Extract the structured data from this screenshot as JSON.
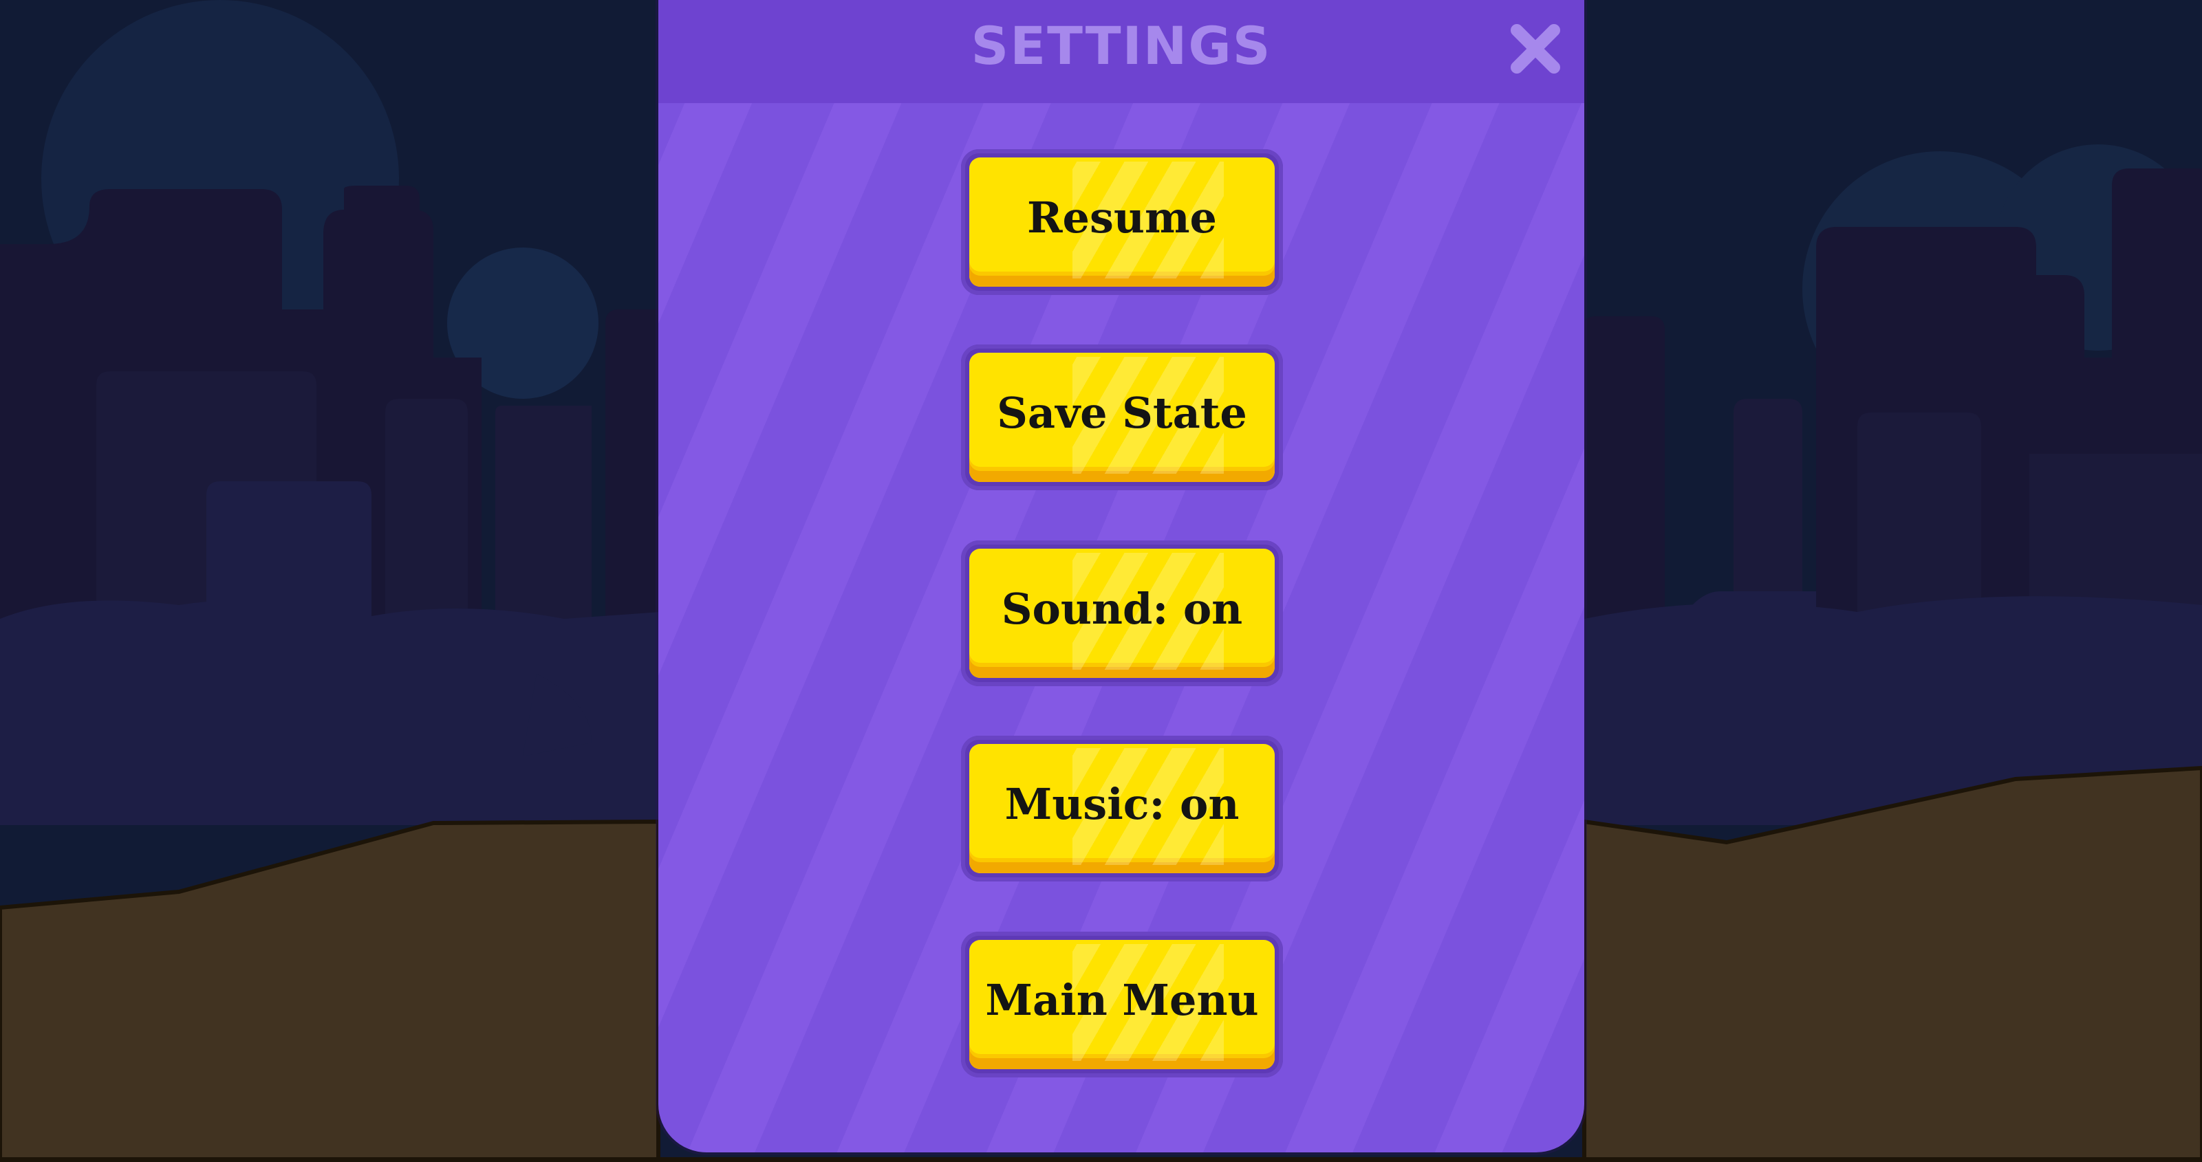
{
  "settings": {
    "title": "SETTINGS",
    "close_icon": "close-icon"
  },
  "menu": {
    "resume": "Resume",
    "save_state": "Save State",
    "sound": "Sound: on",
    "music": "Music: on",
    "main_menu": "Main Menu"
  },
  "colors": {
    "panel": "#7a52dd",
    "panel_header": "#6e43d0",
    "button_face": "#ffe300",
    "background_sky": "#111b35",
    "ground": "#413321"
  }
}
